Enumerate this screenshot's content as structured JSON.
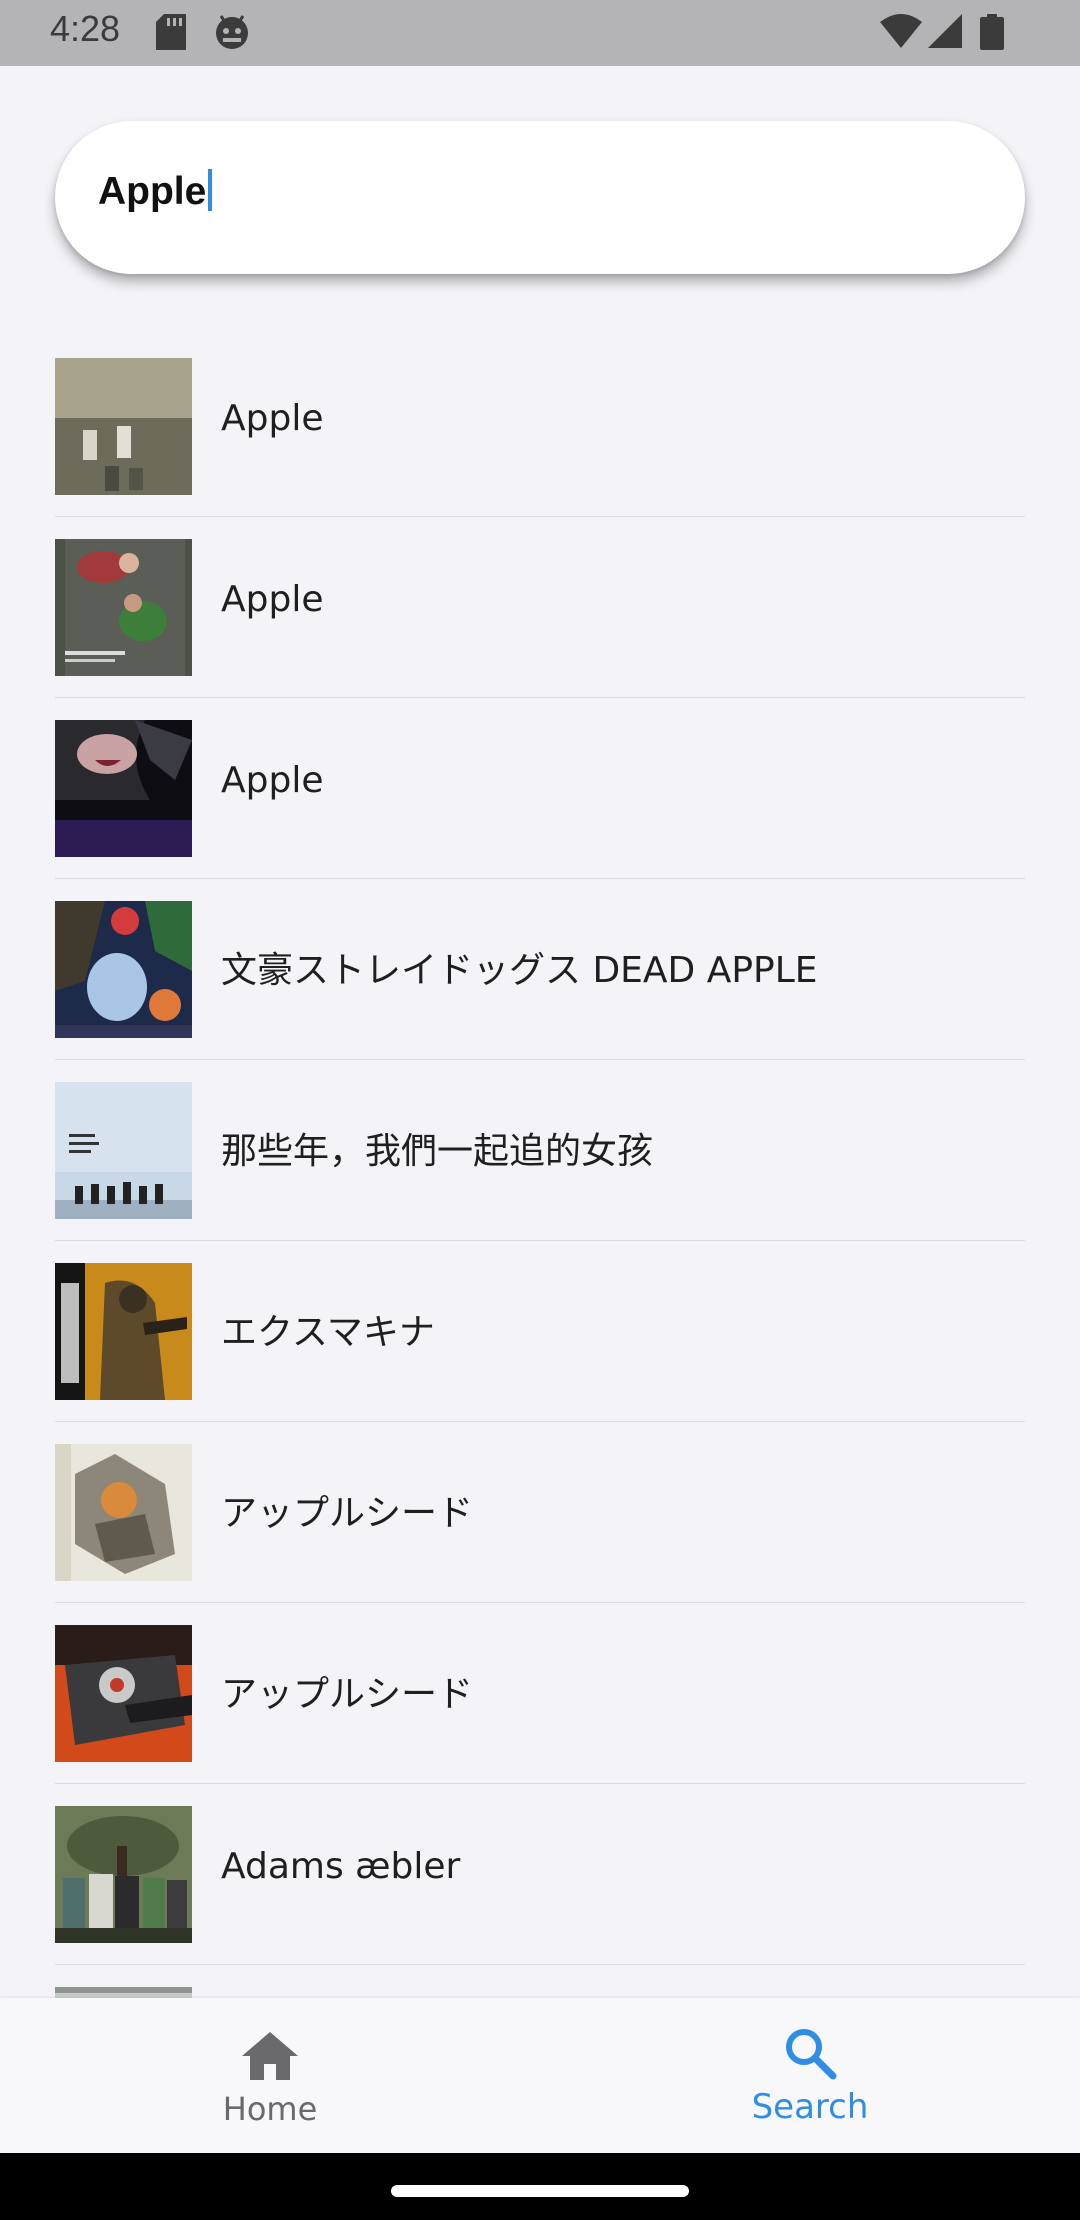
{
  "status_bar": {
    "time": "4:28",
    "icons_left": [
      "sd-card-icon",
      "android-debug-icon"
    ],
    "icons_right": [
      "wifi-icon",
      "signal-icon",
      "battery-icon"
    ]
  },
  "search": {
    "value": "Apple"
  },
  "results": [
    {
      "title": "Apple",
      "thumb_icon": "poster-thumbnail"
    },
    {
      "title": "Apple",
      "thumb_icon": "poster-thumbnail"
    },
    {
      "title": "Apple",
      "thumb_icon": "poster-thumbnail"
    },
    {
      "title": "文豪ストレイドッグス DEAD APPLE",
      "thumb_icon": "poster-thumbnail"
    },
    {
      "title": "那些年，我們一起追的女孩",
      "thumb_icon": "poster-thumbnail"
    },
    {
      "title": "エクスマキナ",
      "thumb_icon": "poster-thumbnail"
    },
    {
      "title": "アップルシード",
      "thumb_icon": "poster-thumbnail"
    },
    {
      "title": "アップルシード",
      "thumb_icon": "poster-thumbnail"
    },
    {
      "title": "Adams æbler",
      "thumb_icon": "poster-thumbnail"
    },
    {
      "title": "",
      "thumb_icon": "poster-thumbnail"
    }
  ],
  "bottom_nav": {
    "home_label": "Home",
    "search_label": "Search",
    "active": "search",
    "active_color": "#2f8de4",
    "inactive_color": "#6a6a6d"
  }
}
